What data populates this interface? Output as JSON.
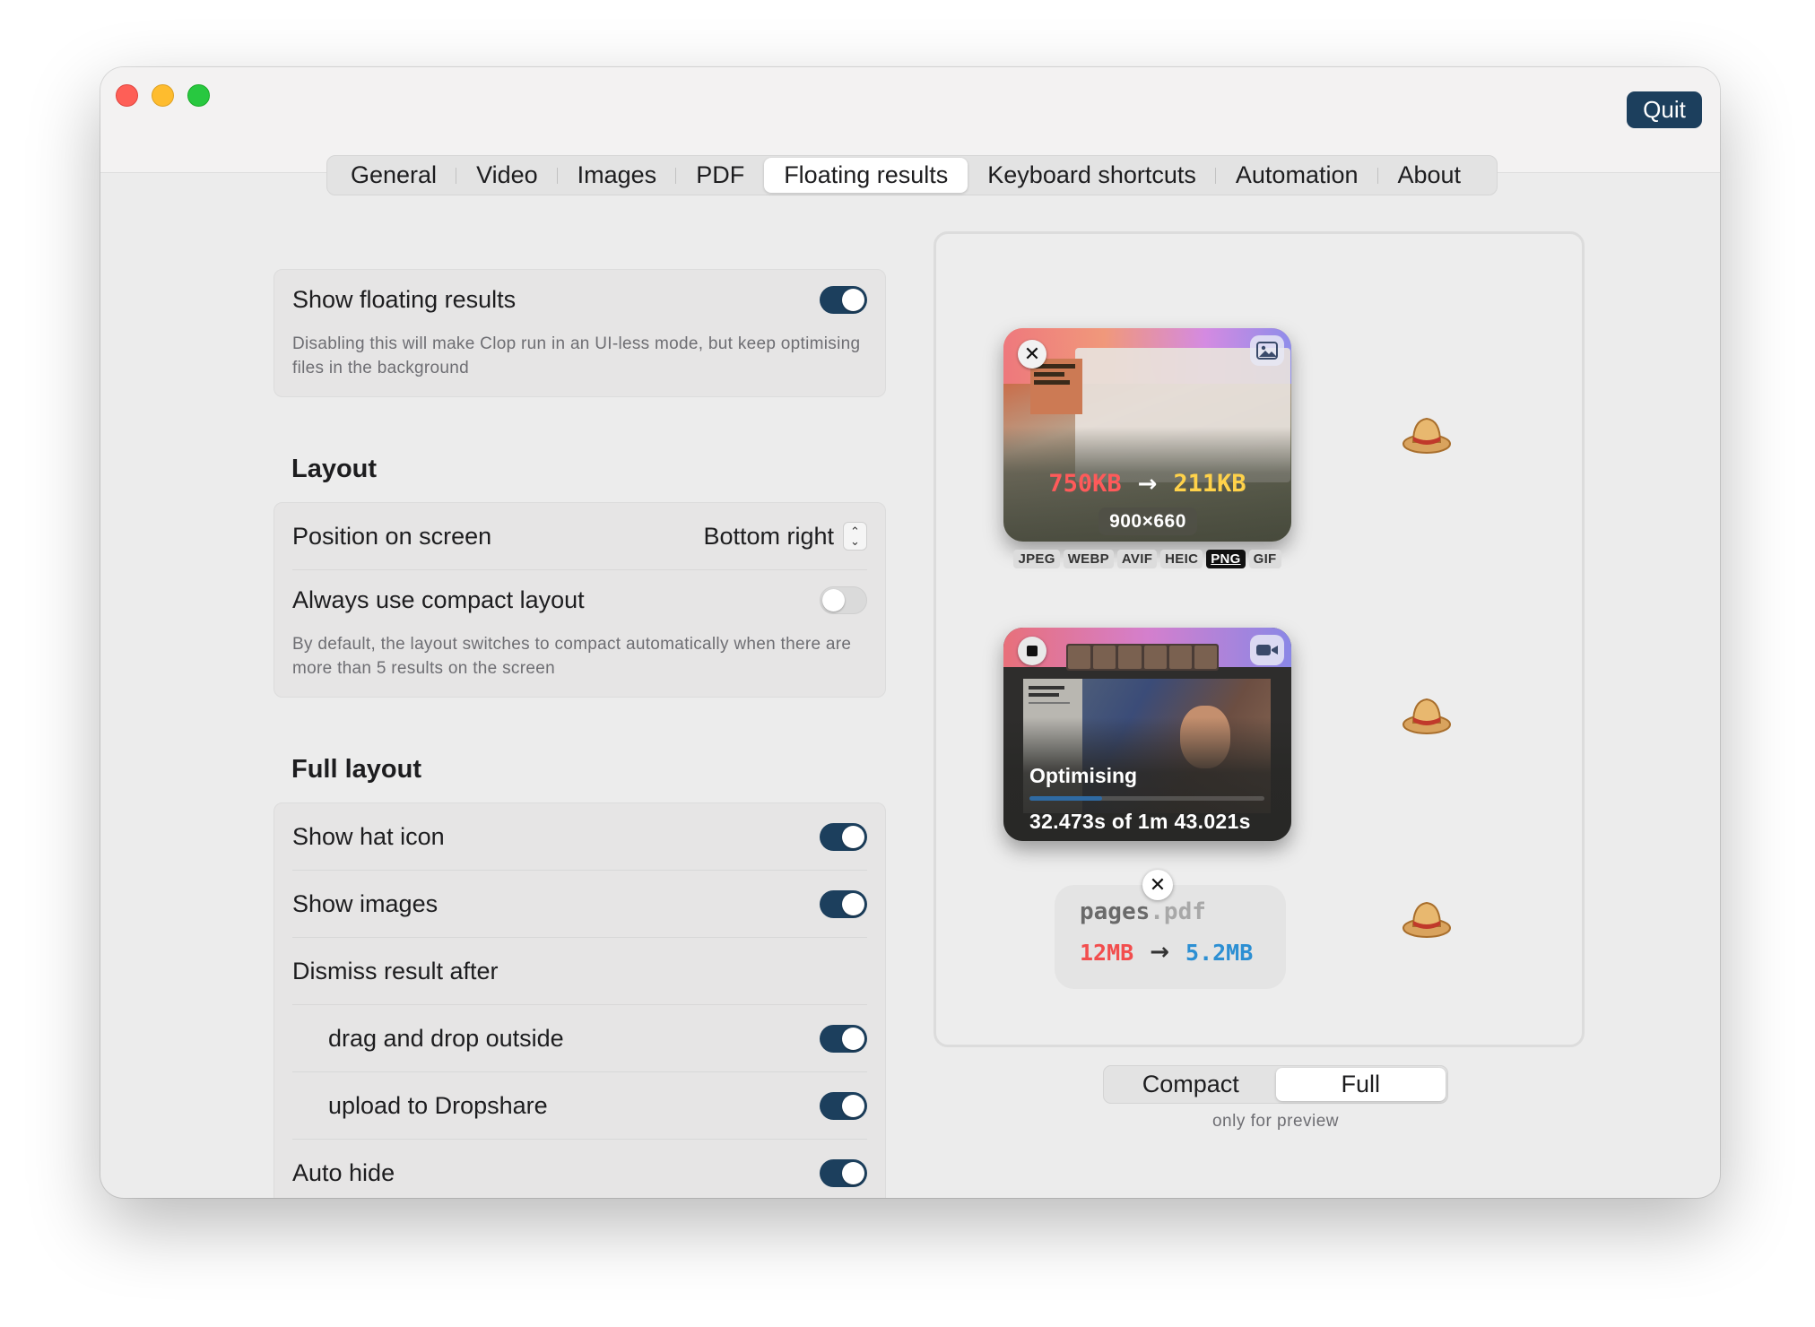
{
  "window": {
    "quit_label": "Quit"
  },
  "tabs": [
    "General",
    "Video",
    "Images",
    "PDF",
    "Floating results",
    "Keyboard shortcuts",
    "Automation",
    "About"
  ],
  "active_tab": "Floating results",
  "settings": {
    "show_floating": {
      "label": "Show floating results",
      "on": true,
      "description": "Disabling this will make Clop run in an UI-less mode, but keep optimising files in the background"
    },
    "layout_title": "Layout",
    "position": {
      "label": "Position on screen",
      "value": "Bottom right"
    },
    "compact": {
      "label": "Always use compact layout",
      "on": false,
      "description": "By default, the layout switches to compact automatically when there are more than 5 results on the screen"
    },
    "full_layout_title": "Full layout",
    "show_hat": {
      "label": "Show hat icon",
      "on": true
    },
    "show_images": {
      "label": "Show images",
      "on": true
    },
    "dismiss_label": "Dismiss result after",
    "drag_drop": {
      "label": "drag and drop outside",
      "on": true
    },
    "upload": {
      "label": "upload to Dropshare",
      "on": true
    },
    "auto_hide": {
      "label": "Auto hide",
      "on": true
    }
  },
  "preview": {
    "image_result": {
      "old_size": "750KB",
      "new_size": "211KB",
      "dimensions": "900×660",
      "arrow": "→",
      "formats": [
        "JPEG",
        "WEBP",
        "AVIF",
        "HEIC",
        "PNG",
        "GIF"
      ],
      "active_format": "PNG"
    },
    "video_result": {
      "status": "Optimising",
      "progress": 0.31,
      "time": "32.473s of 1m 43.021s"
    },
    "pdf_result": {
      "name": "pages",
      "ext": ".pdf",
      "old_size": "12MB",
      "new_size": "5.2MB",
      "arrow": "→"
    }
  },
  "preview_mode": {
    "options": [
      "Compact",
      "Full"
    ],
    "active": "Full",
    "note": "only for preview"
  },
  "colors": {
    "accent": "#1c3f5d",
    "old_size": "#ff5a5a",
    "new_size_image": "#ffd24a",
    "new_size_pdf": "#2c8fd3"
  }
}
